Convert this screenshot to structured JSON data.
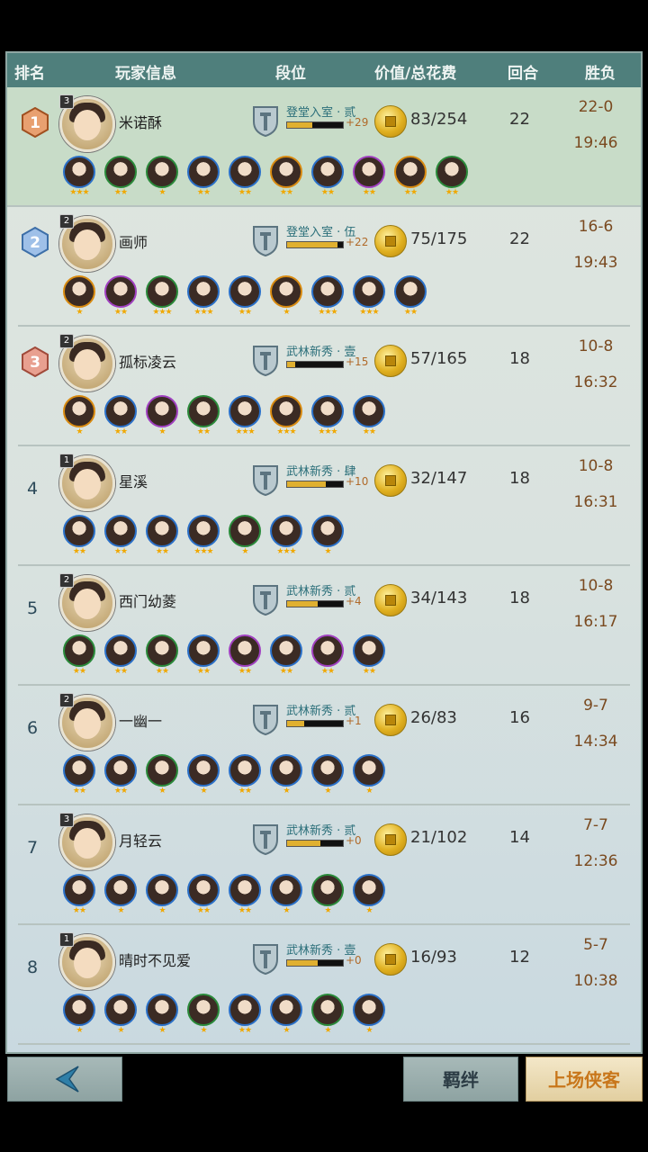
{
  "header": {
    "rank": "排名",
    "player_info": "玩家信息",
    "tier": "段位",
    "value_cost": "价值/总花费",
    "rounds": "回合",
    "win_loss": "胜负"
  },
  "players": [
    {
      "rank": "1",
      "level": "3",
      "name": "米诺酥",
      "tier": "登堂入室 · 贰",
      "tier_progress": 0.45,
      "bonus": "+29",
      "cost": "83/254",
      "rounds": "22",
      "record": "22-0",
      "time": "19:46",
      "heroes": [
        {
          "frame": "c-blue",
          "stars": "★★★"
        },
        {
          "frame": "c-green",
          "stars": "★★"
        },
        {
          "frame": "c-green",
          "stars": "★"
        },
        {
          "frame": "c-blue",
          "stars": "★★"
        },
        {
          "frame": "c-blue",
          "stars": "★★"
        },
        {
          "frame": "c-orange",
          "stars": "★★"
        },
        {
          "frame": "c-blue",
          "stars": "★★"
        },
        {
          "frame": "c-purple",
          "stars": "★★"
        },
        {
          "frame": "c-orange",
          "stars": "★★"
        },
        {
          "frame": "c-green",
          "stars": "★★"
        }
      ]
    },
    {
      "rank": "2",
      "level": "2",
      "name": "画师",
      "tier": "登堂入室 · 伍",
      "tier_progress": 0.9,
      "bonus": "+22",
      "cost": "75/175",
      "rounds": "22",
      "record": "16-6",
      "time": "19:43",
      "heroes": [
        {
          "frame": "c-orange",
          "stars": "★"
        },
        {
          "frame": "c-purple",
          "stars": "★★"
        },
        {
          "frame": "c-green",
          "stars": "★★★"
        },
        {
          "frame": "c-blue",
          "stars": "★★★"
        },
        {
          "frame": "c-blue",
          "stars": "★★"
        },
        {
          "frame": "c-orange",
          "stars": "★"
        },
        {
          "frame": "c-blue",
          "stars": "★★★"
        },
        {
          "frame": "c-blue",
          "stars": "★★★"
        },
        {
          "frame": "c-blue",
          "stars": "★★"
        }
      ]
    },
    {
      "rank": "3",
      "level": "2",
      "name": "孤标凌云",
      "tier": "武林新秀 · 壹",
      "tier_progress": 0.15,
      "bonus": "+15",
      "cost": "57/165",
      "rounds": "18",
      "record": "10-8",
      "time": "16:32",
      "heroes": [
        {
          "frame": "c-orange",
          "stars": "★"
        },
        {
          "frame": "c-blue",
          "stars": "★★"
        },
        {
          "frame": "c-purple",
          "stars": "★"
        },
        {
          "frame": "c-green",
          "stars": "★★"
        },
        {
          "frame": "c-blue",
          "stars": "★★★"
        },
        {
          "frame": "c-orange",
          "stars": "★★★"
        },
        {
          "frame": "c-blue",
          "stars": "★★★"
        },
        {
          "frame": "c-blue",
          "stars": "★★"
        }
      ]
    },
    {
      "rank": "4",
      "level": "1",
      "name": "星溪",
      "tier": "武林新秀 · 肆",
      "tier_progress": 0.7,
      "bonus": "+10",
      "cost": "32/147",
      "rounds": "18",
      "record": "10-8",
      "time": "16:31",
      "heroes": [
        {
          "frame": "c-blue",
          "stars": "★★"
        },
        {
          "frame": "c-blue",
          "stars": "★★"
        },
        {
          "frame": "c-blue",
          "stars": "★★"
        },
        {
          "frame": "c-blue",
          "stars": "★★★"
        },
        {
          "frame": "c-green",
          "stars": "★"
        },
        {
          "frame": "c-blue",
          "stars": "★★★"
        },
        {
          "frame": "c-blue",
          "stars": "★"
        }
      ]
    },
    {
      "rank": "5",
      "level": "2",
      "name": "西门幼菱",
      "tier": "武林新秀 · 贰",
      "tier_progress": 0.55,
      "bonus": "+4",
      "cost": "34/143",
      "rounds": "18",
      "record": "10-8",
      "time": "16:17",
      "heroes": [
        {
          "frame": "c-green",
          "stars": "★★"
        },
        {
          "frame": "c-blue",
          "stars": "★★"
        },
        {
          "frame": "c-green",
          "stars": "★★"
        },
        {
          "frame": "c-blue",
          "stars": "★★"
        },
        {
          "frame": "c-purple",
          "stars": "★★"
        },
        {
          "frame": "c-blue",
          "stars": "★★"
        },
        {
          "frame": "c-purple",
          "stars": "★★"
        },
        {
          "frame": "c-blue",
          "stars": "★★"
        }
      ]
    },
    {
      "rank": "6",
      "level": "2",
      "name": "一幽一",
      "tier": "武林新秀 · 贰",
      "tier_progress": 0.3,
      "bonus": "+1",
      "cost": "26/83",
      "rounds": "16",
      "record": "9-7",
      "time": "14:34",
      "heroes": [
        {
          "frame": "c-blue",
          "stars": "★★"
        },
        {
          "frame": "c-blue",
          "stars": "★★"
        },
        {
          "frame": "c-green",
          "stars": "★"
        },
        {
          "frame": "c-blue",
          "stars": "★"
        },
        {
          "frame": "c-blue",
          "stars": "★★"
        },
        {
          "frame": "c-blue",
          "stars": "★"
        },
        {
          "frame": "c-blue",
          "stars": "★"
        },
        {
          "frame": "c-blue",
          "stars": "★"
        }
      ]
    },
    {
      "rank": "7",
      "level": "3",
      "name": "月轻云",
      "tier": "武林新秀 · 贰",
      "tier_progress": 0.6,
      "bonus": "+0",
      "cost": "21/102",
      "rounds": "14",
      "record": "7-7",
      "time": "12:36",
      "heroes": [
        {
          "frame": "c-blue",
          "stars": "★★"
        },
        {
          "frame": "c-blue",
          "stars": "★"
        },
        {
          "frame": "c-blue",
          "stars": "★"
        },
        {
          "frame": "c-blue",
          "stars": "★★"
        },
        {
          "frame": "c-blue",
          "stars": "★★"
        },
        {
          "frame": "c-blue",
          "stars": "★"
        },
        {
          "frame": "c-green",
          "stars": "★"
        },
        {
          "frame": "c-blue",
          "stars": "★"
        }
      ]
    },
    {
      "rank": "8",
      "level": "1",
      "name": "晴时不见爱",
      "tier": "武林新秀 · 壹",
      "tier_progress": 0.55,
      "bonus": "+0",
      "cost": "16/93",
      "rounds": "12",
      "record": "5-7",
      "time": "10:38",
      "heroes": [
        {
          "frame": "c-blue",
          "stars": "★"
        },
        {
          "frame": "c-blue",
          "stars": "★"
        },
        {
          "frame": "c-blue",
          "stars": "★"
        },
        {
          "frame": "c-green",
          "stars": "★"
        },
        {
          "frame": "c-blue",
          "stars": "★★"
        },
        {
          "frame": "c-blue",
          "stars": "★"
        },
        {
          "frame": "c-green",
          "stars": "★"
        },
        {
          "frame": "c-blue",
          "stars": "★"
        }
      ]
    }
  ],
  "footer": {
    "bonds": "羁绊",
    "deploy": "上场侠客"
  }
}
